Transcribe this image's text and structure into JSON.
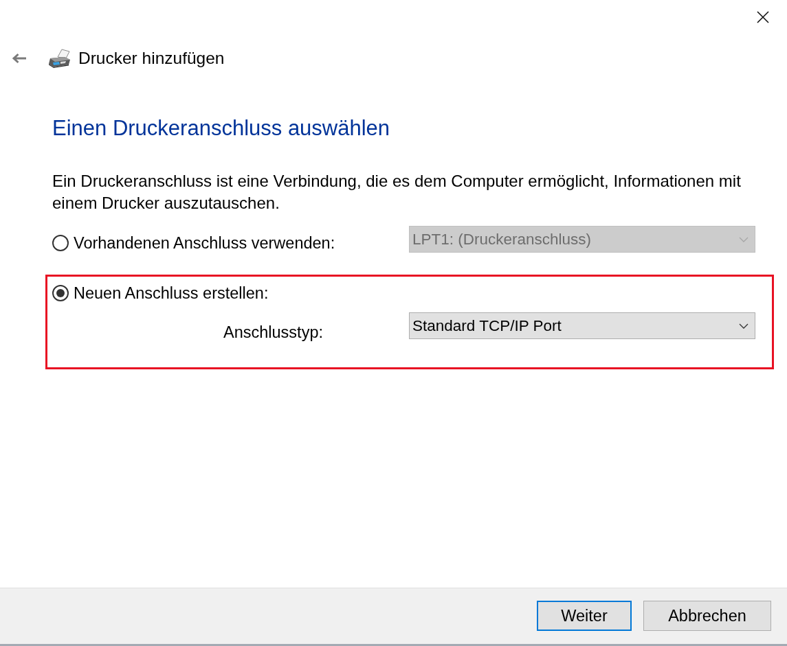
{
  "header": {
    "title": "Drucker hinzufügen"
  },
  "heading": "Einen Druckeranschluss auswählen",
  "description": "Ein Druckeranschluss ist eine Verbindung, die es dem Computer ermöglicht, Informationen mit einem Drucker auszutauschen.",
  "options": [
    {
      "kind": "inline",
      "label": "Vorhandenen Anschluss verwenden:",
      "selected": false,
      "highlighted": false,
      "dropdown": {
        "value": "LPT1: (Druckeranschluss)",
        "disabled": true
      }
    },
    {
      "kind": "nested",
      "label": "Neuen Anschluss erstellen:",
      "selected": true,
      "highlighted": true,
      "field_label": "Anschlusstyp:",
      "dropdown": {
        "value": "Standard TCP/IP Port",
        "disabled": false
      }
    }
  ],
  "buttons": [
    {
      "label": "Weiter",
      "focused": true
    },
    {
      "label": "Abbrechen",
      "focused": false
    }
  ]
}
